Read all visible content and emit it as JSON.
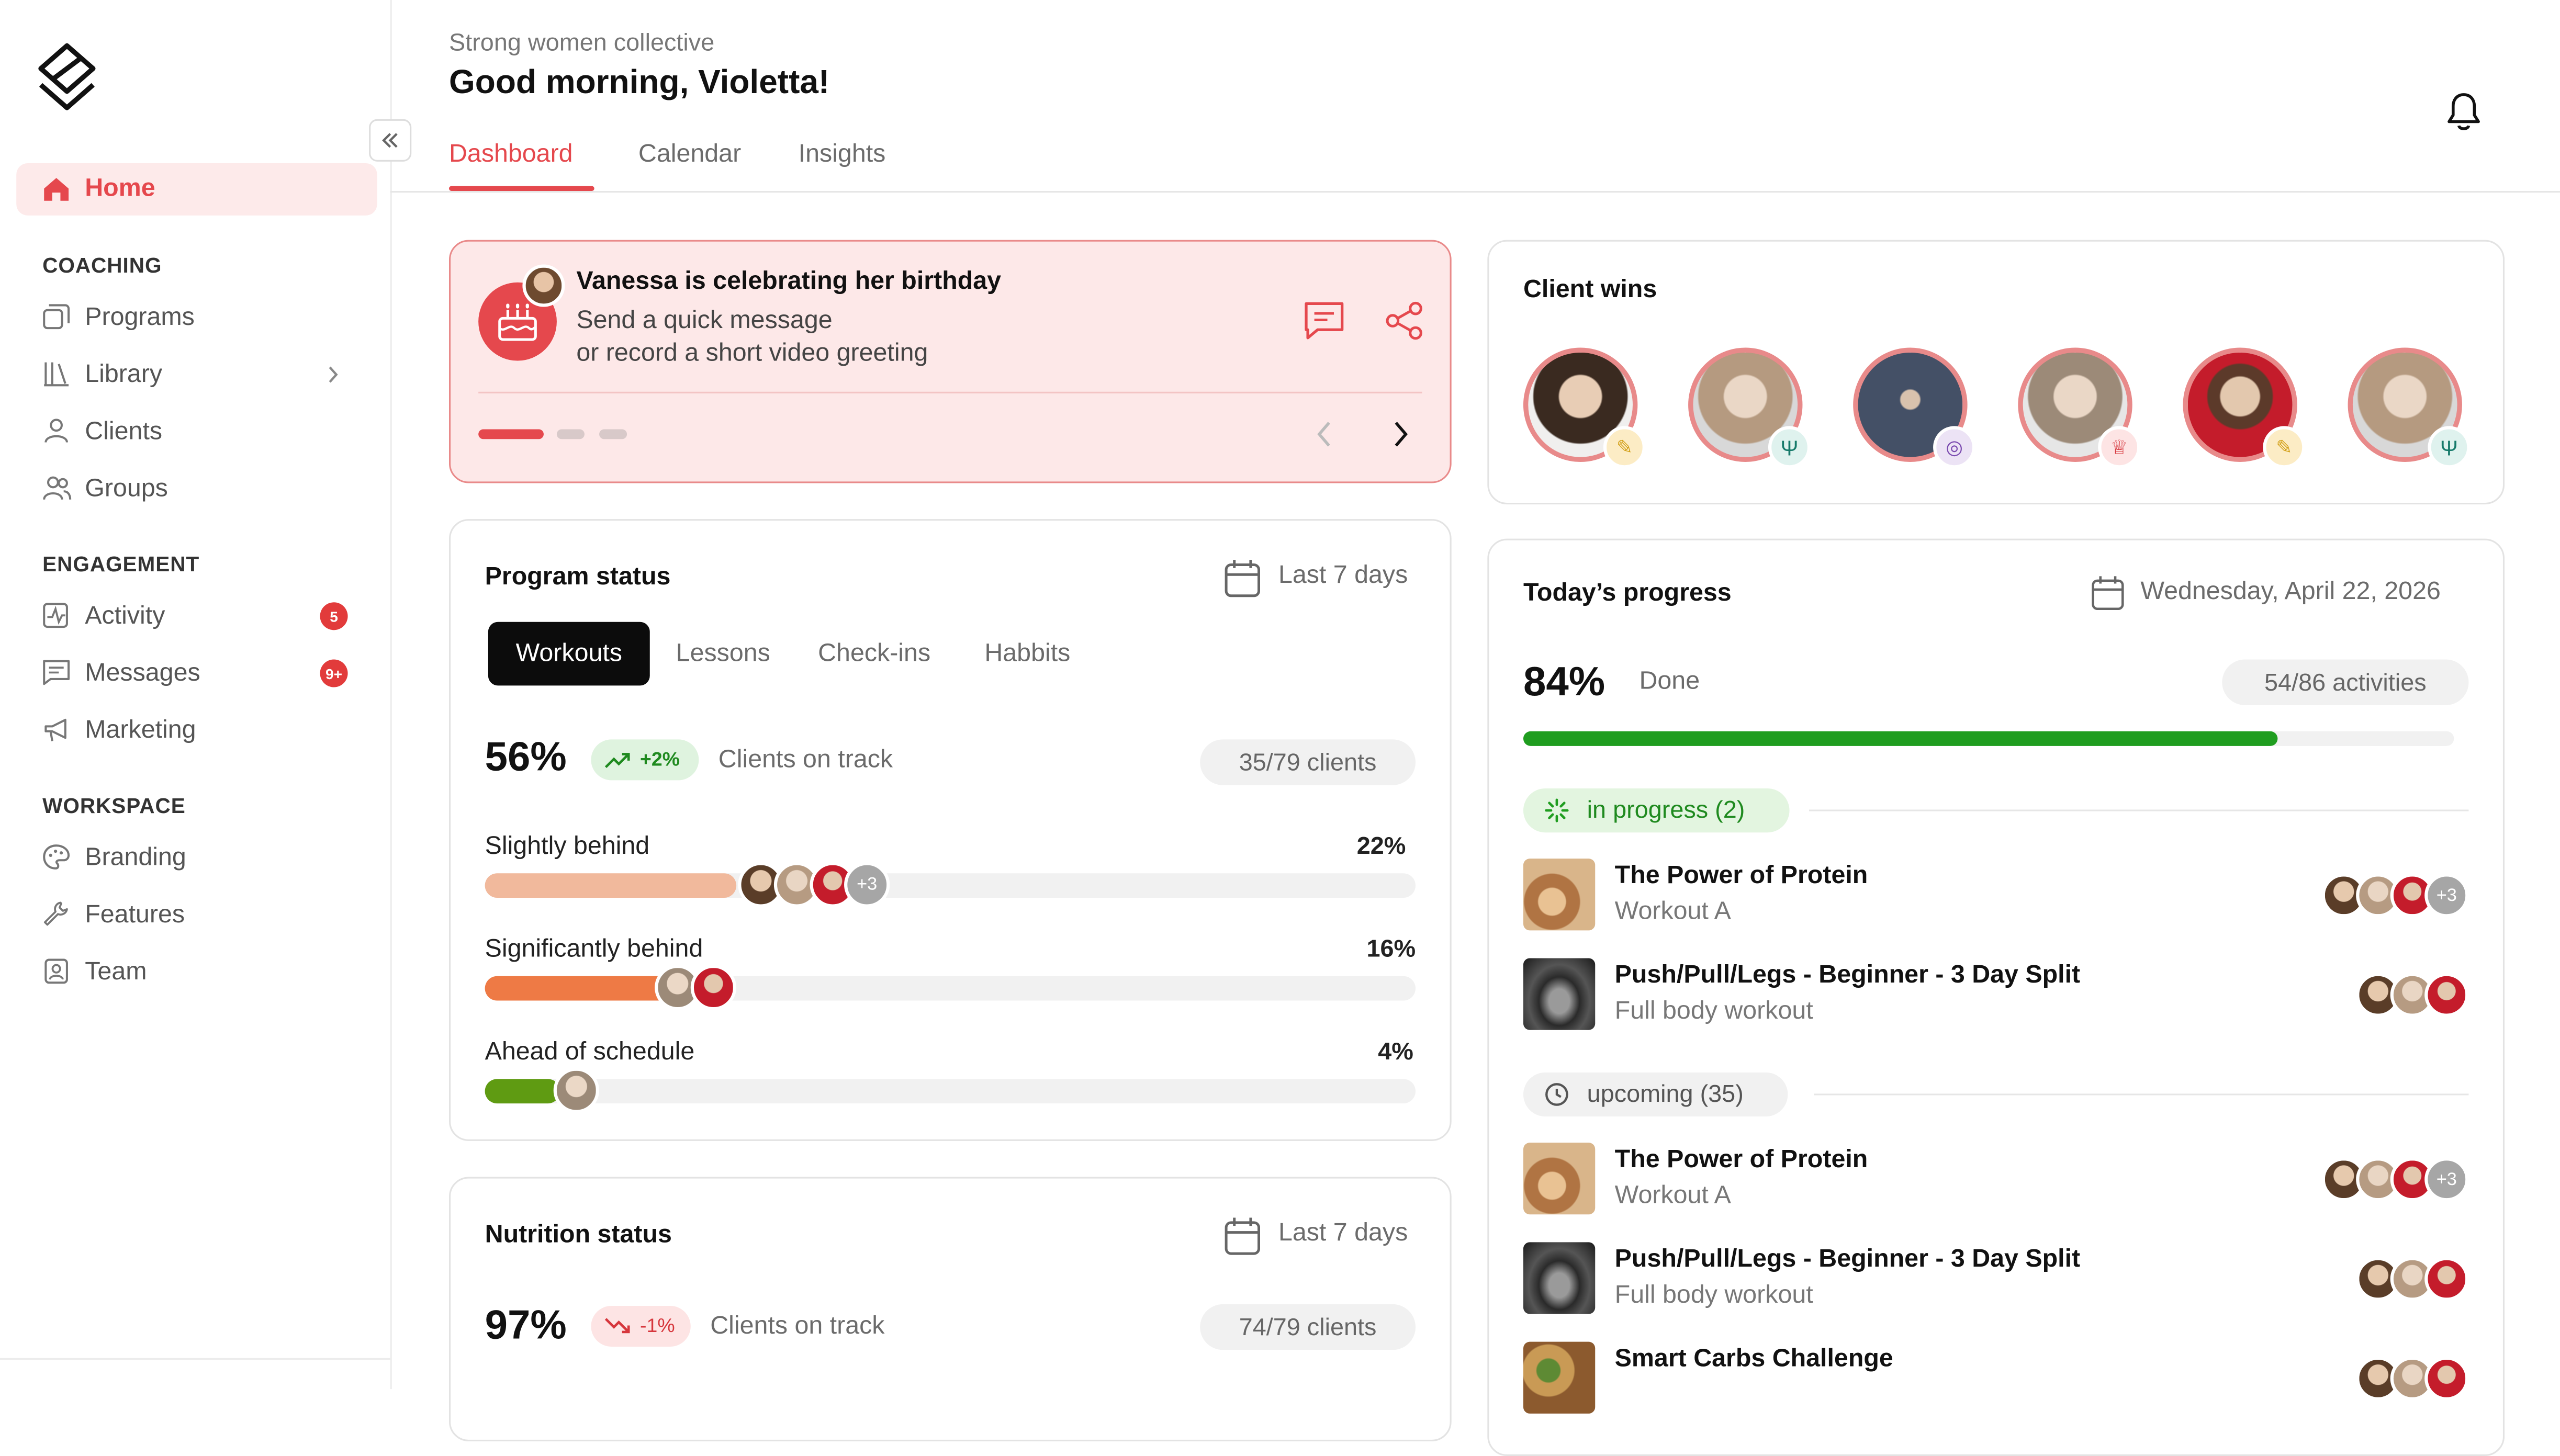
{
  "workspace_name": "Strong women collective",
  "greeting": "Good morning, Violetta!",
  "tabs": [
    "Dashboard",
    "Calendar",
    "Insights"
  ],
  "sidebar": {
    "home": "Home",
    "sections": [
      {
        "heading": "COACHING",
        "items": [
          "Programs",
          "Library",
          "Clients",
          "Groups"
        ]
      },
      {
        "heading": "ENGAGEMENT",
        "items": [
          "Activity",
          "Messages",
          "Marketing"
        ]
      },
      {
        "heading": "WORKSPACE",
        "items": [
          "Branding",
          "Features",
          "Team"
        ]
      }
    ],
    "badges": {
      "activity": "5",
      "messages": "9+"
    }
  },
  "birthday": {
    "title": "Vanessa is celebrating her birthday",
    "line1": "Send a quick message",
    "line2": "or record a short video greeting",
    "active_slide": 1,
    "slides": 3
  },
  "program_status": {
    "title": "Program status",
    "period": "Last 7 days",
    "tabs": [
      "Workouts",
      "Lessons",
      "Check-ins",
      "Habbits"
    ],
    "percent": "56%",
    "delta": "+2%",
    "label": "Clients on track",
    "count": "35/79 clients",
    "rows": [
      {
        "label": "Slightly behind",
        "value": "22%",
        "fill": 0.27,
        "color": "#f1b99c",
        "more": "+3"
      },
      {
        "label": "Significantly behind",
        "value": "16%",
        "fill": 0.2,
        "color": "#ee7a45"
      },
      {
        "label": "Ahead of schedule",
        "value": "4%",
        "fill": 0.08,
        "color": "#5f9b12"
      }
    ]
  },
  "nutrition_status": {
    "title": "Nutrition status",
    "period": "Last 7 days",
    "percent": "97%",
    "delta": "-1%",
    "label": "Clients on track",
    "count": "74/79 clients"
  },
  "client_wins": {
    "title": "Client wins"
  },
  "todays_progress": {
    "title": "Today’s progress",
    "date": "Wednesday, April 22, 2026",
    "percent": "84%",
    "done_label": "Done",
    "activities": "54/86 activities",
    "fill": 0.81,
    "in_progress_label": "in progress (2)",
    "upcoming_label": "upcoming (35)",
    "in_progress": [
      {
        "title": "The Power of Protein",
        "sub": "Workout A",
        "more": "+3"
      },
      {
        "title": "Push/Pull/Legs - Beginner - 3 Day Split",
        "sub": "Full body workout"
      }
    ],
    "upcoming": [
      {
        "title": "The Power of Protein",
        "sub": "Workout A",
        "more": "+3"
      },
      {
        "title": "Push/Pull/Legs - Beginner - 3 Day Split",
        "sub": "Full body workout"
      },
      {
        "title": "Smart Carbs Challenge",
        "sub": ""
      }
    ]
  },
  "colors": {
    "accent": "#e5484d",
    "green": "#1f9d1f",
    "card_pink": "#fde8e8"
  }
}
